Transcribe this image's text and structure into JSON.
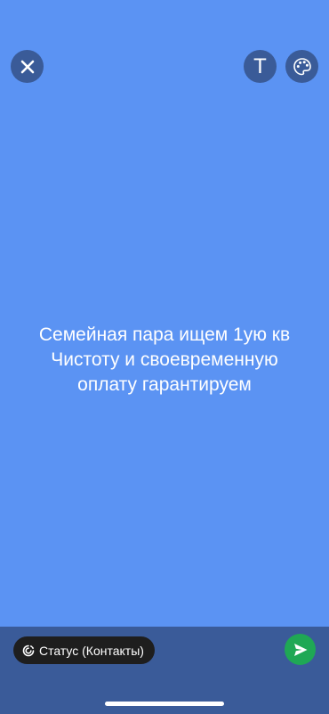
{
  "colors": {
    "background": "#5b93f3",
    "toolbar_button": "#3a5b98",
    "bottom_bar": "#3a5b99",
    "chip": "#1e1e1e",
    "send": "#1fa855",
    "text": "#ffffff"
  },
  "toolbar": {
    "close_icon": "close-icon",
    "text_tool_glyph": "T",
    "palette_icon": "palette-icon"
  },
  "status": {
    "lines": [
      "Семейная пара ищем 1ую кв",
      "Чистоту и своевременную",
      "оплату гарантируем"
    ]
  },
  "footer": {
    "audience_icon": "status-ring-icon",
    "audience_label": "Статус (Контакты)",
    "send_icon": "send-icon"
  }
}
